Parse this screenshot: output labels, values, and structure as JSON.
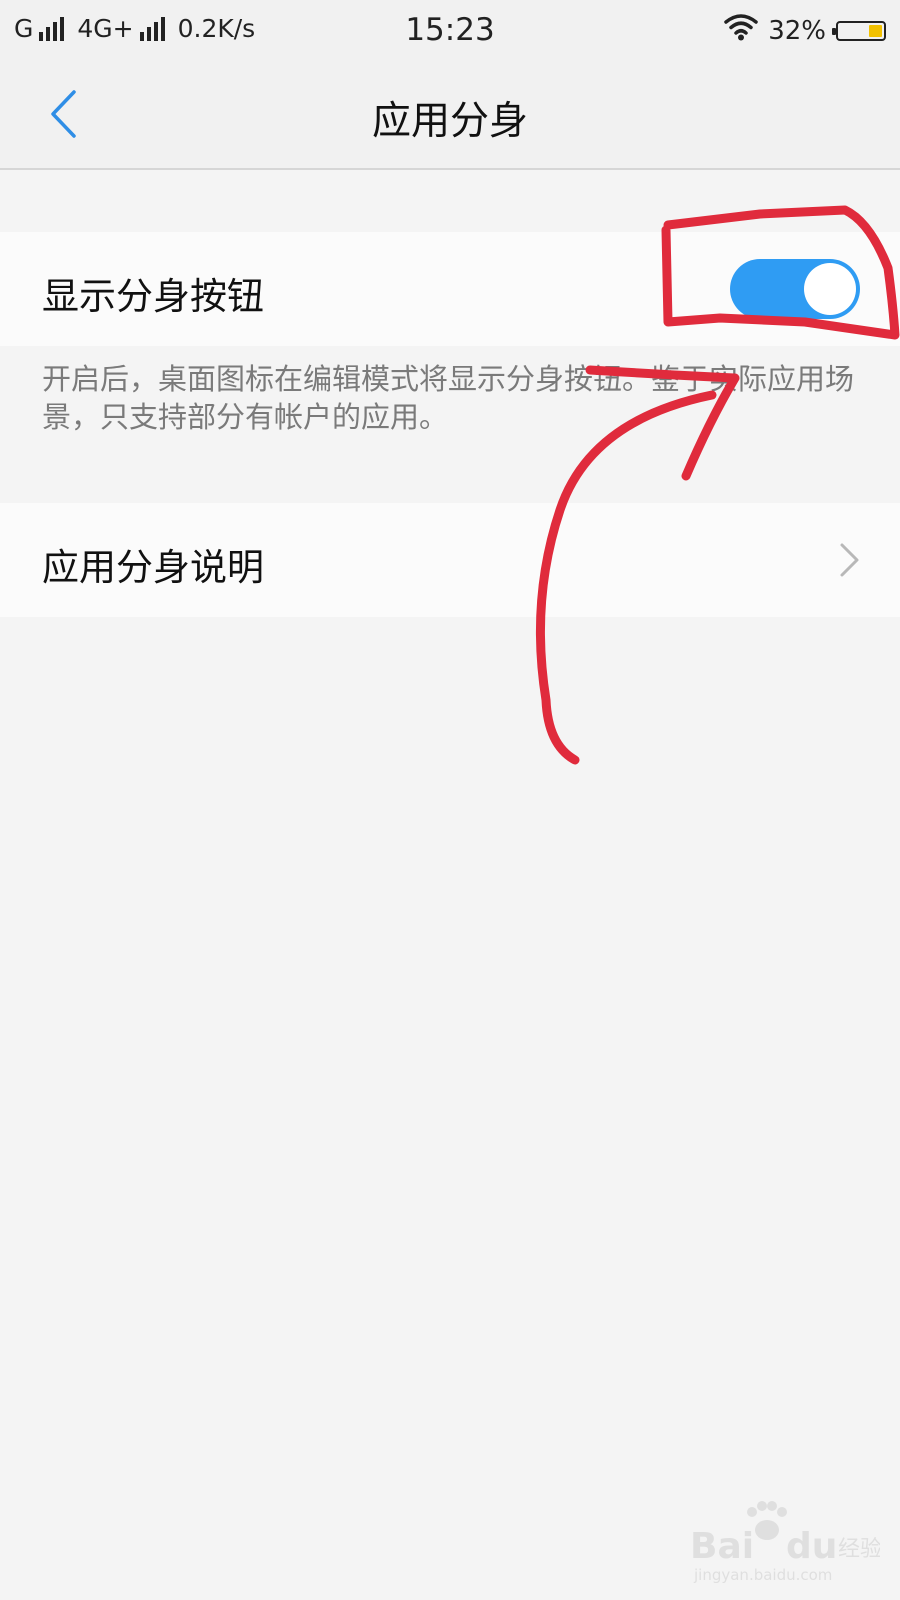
{
  "status_bar": {
    "carrier1": "G",
    "carrier2": "4G+",
    "speed": "0.2K/s",
    "time": "15:23",
    "battery": "32%",
    "battery_level": 0.32,
    "battery_color": "#f2c100"
  },
  "title_bar": {
    "title": "应用分身",
    "back_icon": "chevron-left-icon"
  },
  "settings": {
    "show_clone_button": {
      "label": "显示分身按钮",
      "enabled": true,
      "color": "#2f9cf3"
    },
    "description": "开启后，桌面图标在编辑模式将显示分身按钮。鉴于实际应用场景，只支持部分有帐户的应用。",
    "clone_info": {
      "label": "应用分身说明",
      "icon": "chevron-right-icon"
    }
  },
  "annotation": {
    "color": "#e02b3c"
  },
  "watermark": {
    "text": "Baidu经验",
    "url": "jingyan.baidu.com"
  }
}
